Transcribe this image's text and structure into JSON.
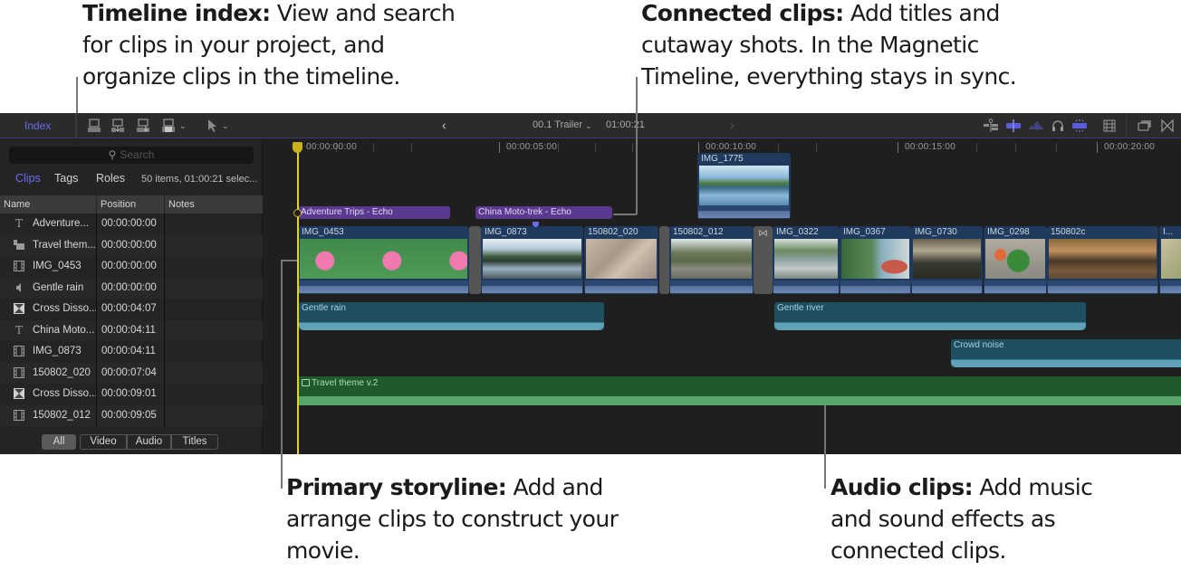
{
  "callouts": {
    "timeline_index": {
      "title": "Timeline index:",
      "text": " View and search for clips in your project, and organize clips in the timeline."
    },
    "connected_clips": {
      "title": "Connected clips:",
      "text": " Add titles and cutaway shots. In the Magnetic Timeline, everything stays in sync."
    },
    "primary_storyline": {
      "title": "Primary storyline:",
      "text": " Add and arrange clips to construct your movie."
    },
    "audio_clips": {
      "title": "Audio clips:",
      "text": " Add music and sound effects as connected clips."
    }
  },
  "toolbar": {
    "index_label": "Index",
    "project_name": "00.1 Trailer",
    "project_duration": "01:00:21",
    "icons": [
      "append-clip-icon",
      "insert-clip-icon",
      "connect-clip-icon",
      "overwrite-clip-icon",
      "select-tool-icon",
      "skimming-icon",
      "clip-skimming-icon",
      "audio-skimming-icon",
      "solo-icon",
      "snapping-icon",
      "clip-appearance-icon",
      "effects-browser-icon",
      "transitions-browser-icon"
    ]
  },
  "index_panel": {
    "search_placeholder": "Search",
    "tabs": [
      {
        "label": "Clips",
        "active": true
      },
      {
        "label": "Tags",
        "active": false
      },
      {
        "label": "Roles",
        "active": false
      }
    ],
    "status": "50 items, 01:00:21 selec...",
    "columns": [
      "Name",
      "Position",
      "Notes"
    ],
    "rows": [
      {
        "icon": "title-icon",
        "name": "Adventure...",
        "position": "00:00:00:00",
        "notes": ""
      },
      {
        "icon": "music-icon",
        "name": "Travel them...",
        "position": "00:00:00:00",
        "notes": ""
      },
      {
        "icon": "film-icon",
        "name": "IMG_0453",
        "position": "00:00:00:00",
        "notes": ""
      },
      {
        "icon": "speaker-icon",
        "name": "Gentle rain",
        "position": "00:00:00:00",
        "notes": ""
      },
      {
        "icon": "transition-icon",
        "name": "Cross Disso...",
        "position": "00:00:04:07",
        "notes": ""
      },
      {
        "icon": "title-icon",
        "name": "China Moto...",
        "position": "00:00:04:11",
        "notes": ""
      },
      {
        "icon": "film-icon",
        "name": "IMG_0873",
        "position": "00:00:04:11",
        "notes": ""
      },
      {
        "icon": "film-icon",
        "name": "150802_020",
        "position": "00:00:07:04",
        "notes": ""
      },
      {
        "icon": "transition-icon",
        "name": "Cross Disso...",
        "position": "00:00:09:01",
        "notes": ""
      },
      {
        "icon": "film-icon",
        "name": "150802_012",
        "position": "00:00:09:05",
        "notes": ""
      }
    ],
    "filters": [
      {
        "label": "All",
        "active": true
      },
      {
        "label": "Video",
        "active": false
      },
      {
        "label": "Audio",
        "active": false
      },
      {
        "label": "Titles",
        "active": false
      }
    ]
  },
  "timeline": {
    "ruler_labels": [
      "00:00:00:00",
      "00:00:05:00",
      "00:00:10:00",
      "00:00:15:00",
      "00:00:20:00"
    ],
    "connected_video": [
      {
        "name": "IMG_1775"
      }
    ],
    "titles": [
      {
        "name": "Adventure Trips - Echo"
      },
      {
        "name": "China Moto-trek - Echo"
      }
    ],
    "primary_storyline": [
      {
        "name": "IMG_0453"
      },
      {
        "name": "IMG_0873"
      },
      {
        "name": "150802_020"
      },
      {
        "name": "150802_012"
      },
      {
        "name": "IMG_0322"
      },
      {
        "name": "IMG_0367"
      },
      {
        "name": "IMG_0730"
      },
      {
        "name": "IMG_0298"
      },
      {
        "name": "150802c"
      },
      {
        "name": "I..."
      }
    ],
    "audio_clips": [
      {
        "name": "Gentle rain"
      },
      {
        "name": "Gentle river"
      },
      {
        "name": "Crowd noise"
      }
    ],
    "music": {
      "name": "Travel theme v.2"
    }
  },
  "colors": {
    "accent": "#6a6cf0",
    "playhead": "#e6d31c",
    "video_clip": "#1f3a5c",
    "title_clip": "#5a3a90",
    "audio_clip": "#1d4f61",
    "music_clip": "#1f5a2d"
  }
}
